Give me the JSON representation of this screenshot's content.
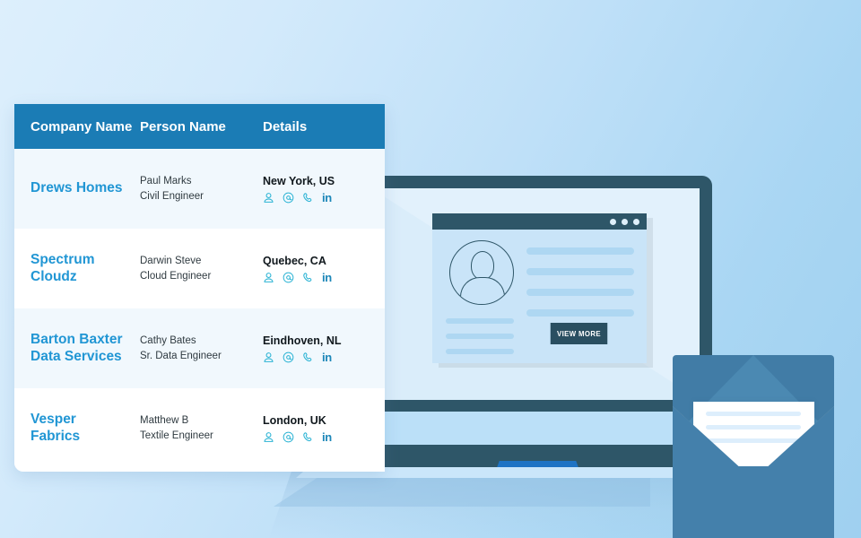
{
  "background": {
    "gradient_from": "#ddeffc",
    "gradient_to": "#9fd0f0"
  },
  "table": {
    "header_color": "#1b7cb5",
    "company_link_color": "#2196d4",
    "columns": [
      {
        "key": "company",
        "label": "Company Name"
      },
      {
        "key": "person",
        "label": "Person Name"
      },
      {
        "key": "details",
        "label": "Details"
      }
    ],
    "rows": [
      {
        "company_line1": "Drews Homes",
        "company_line2": "",
        "person_name": "Paul Marks",
        "person_title": "Civil Engineer",
        "location": "New York, US",
        "icons": [
          "person-icon",
          "email-icon",
          "phone-icon",
          "linkedin-icon"
        ],
        "linkedin_label": "in"
      },
      {
        "company_line1": "Spectrum",
        "company_line2": "Cloudz",
        "person_name": "Darwin Steve",
        "person_title": "Cloud Engineer",
        "location": "Quebec, CA",
        "icons": [
          "person-icon",
          "email-icon",
          "phone-icon",
          "linkedin-icon"
        ],
        "linkedin_label": "in"
      },
      {
        "company_line1": "Barton Baxter",
        "company_line2": "Data Services",
        "person_name": "Cathy Bates",
        "person_title": "Sr. Data Engineer",
        "location": "Eindhoven, NL",
        "icons": [
          "person-icon",
          "email-icon",
          "phone-icon",
          "linkedin-icon"
        ],
        "linkedin_label": "in"
      },
      {
        "company_line1": "Vesper",
        "company_line2": "Fabrics",
        "person_name": "Matthew B",
        "person_title": "Textile Engineer",
        "location": "London, UK",
        "icons": [
          "person-icon",
          "email-icon",
          "phone-icon",
          "linkedin-icon"
        ],
        "linkedin_label": "in"
      }
    ]
  },
  "illustration": {
    "laptop": {
      "bezel_color": "#2e5668",
      "screen_color": "#e2f1fc",
      "trackpad_color": "#1e73c4",
      "browser": {
        "bar_color": "#2e5668",
        "body_color": "#c9e4f8",
        "window_dots": 3,
        "avatar": "user-avatar-icon",
        "text_lines_right": 4,
        "text_lines_left": 3,
        "button_label": "VIEW MORE",
        "button_color": "#2a4f61"
      }
    },
    "envelope": {
      "body_color": "#4480ab",
      "flap_color": "#4b89b2",
      "letter_color": "#ffffff",
      "letter_lines": 3
    }
  }
}
